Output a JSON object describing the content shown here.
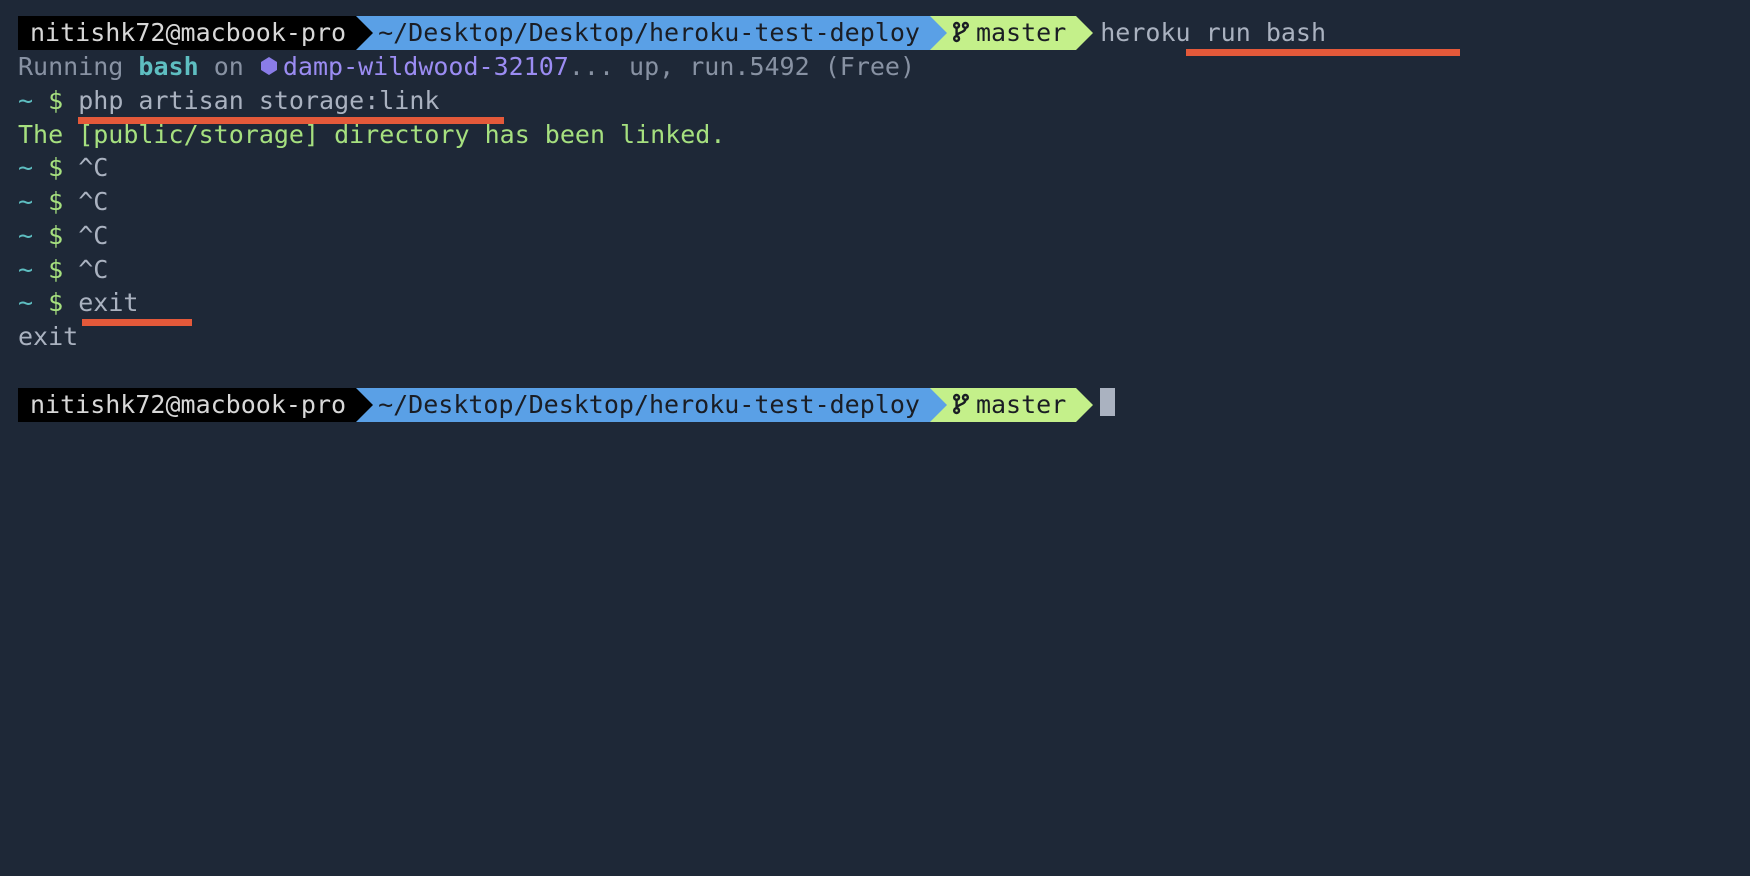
{
  "prompt1": {
    "user": "nitishk72@macbook-pro",
    "path": "~/Desktop/Desktop/heroku-test-deploy",
    "branch": "master",
    "command": "heroku run bash"
  },
  "output": {
    "running_prefix": "Running ",
    "running_cmd": "bash",
    "running_on": " on ",
    "app_name": "damp-wildwood-32107",
    "running_suffix": "... up, run.5492 (Free)",
    "remote_prompt_tilde": "~ ",
    "remote_prompt_dollar": "$ ",
    "cmd_storage": "php artisan storage:link",
    "linked_msg": "The [public/storage] directory has been linked.",
    "ctrlc": "^C",
    "cmd_exit": "exit",
    "exit_echo": "exit"
  },
  "prompt2": {
    "user": "nitishk72@macbook-pro",
    "path": "~/Desktop/Desktop/heroku-test-deploy",
    "branch": "master"
  }
}
